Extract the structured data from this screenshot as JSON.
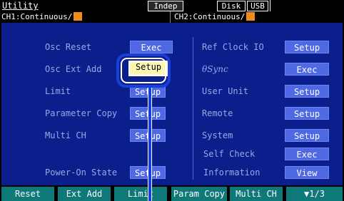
{
  "status_bar": {
    "title": "Utility",
    "mode_badge": "Indep",
    "disk_badge": "Disk",
    "usb_badge": "USB",
    "ch1_label": "CH1:Continuous/",
    "ch2_label": "CH2:Continuous/"
  },
  "left_column": [
    {
      "label": "Osc Reset",
      "button": "Exec"
    },
    {
      "label": "Osc Ext Add",
      "button": "Setup"
    },
    {
      "label": "Limit",
      "button": "Setup"
    },
    {
      "label": "Parameter Copy",
      "button": "Setup"
    },
    {
      "label": "Multi CH",
      "button": "Setup"
    },
    {
      "label": "Power-On State",
      "button": "Setup"
    }
  ],
  "right_column": [
    {
      "label": "Ref Clock IO",
      "button": "Setup"
    },
    {
      "label": "θSync",
      "button": "Exec"
    },
    {
      "label": "User Unit",
      "button": "Setup"
    },
    {
      "label": "Remote",
      "button": "Setup"
    },
    {
      "label": "System",
      "button": "Setup"
    },
    {
      "label": "Self Check",
      "button": "Exec"
    },
    {
      "label": "Information",
      "button": "View"
    }
  ],
  "soft_keys": [
    "Reset",
    "Ext Add",
    "Limit",
    "Param Copy",
    "Multi CH",
    "▼1/3"
  ],
  "colors": {
    "panel_bg": "#0b1f8c",
    "button_bg": "#4f69e4",
    "selected_button_bg": "#fdf6b4",
    "softkey_bg": "#0f7878",
    "indicator_orange": "#f08b1e",
    "annotation_blue": "#1a3fd8"
  }
}
